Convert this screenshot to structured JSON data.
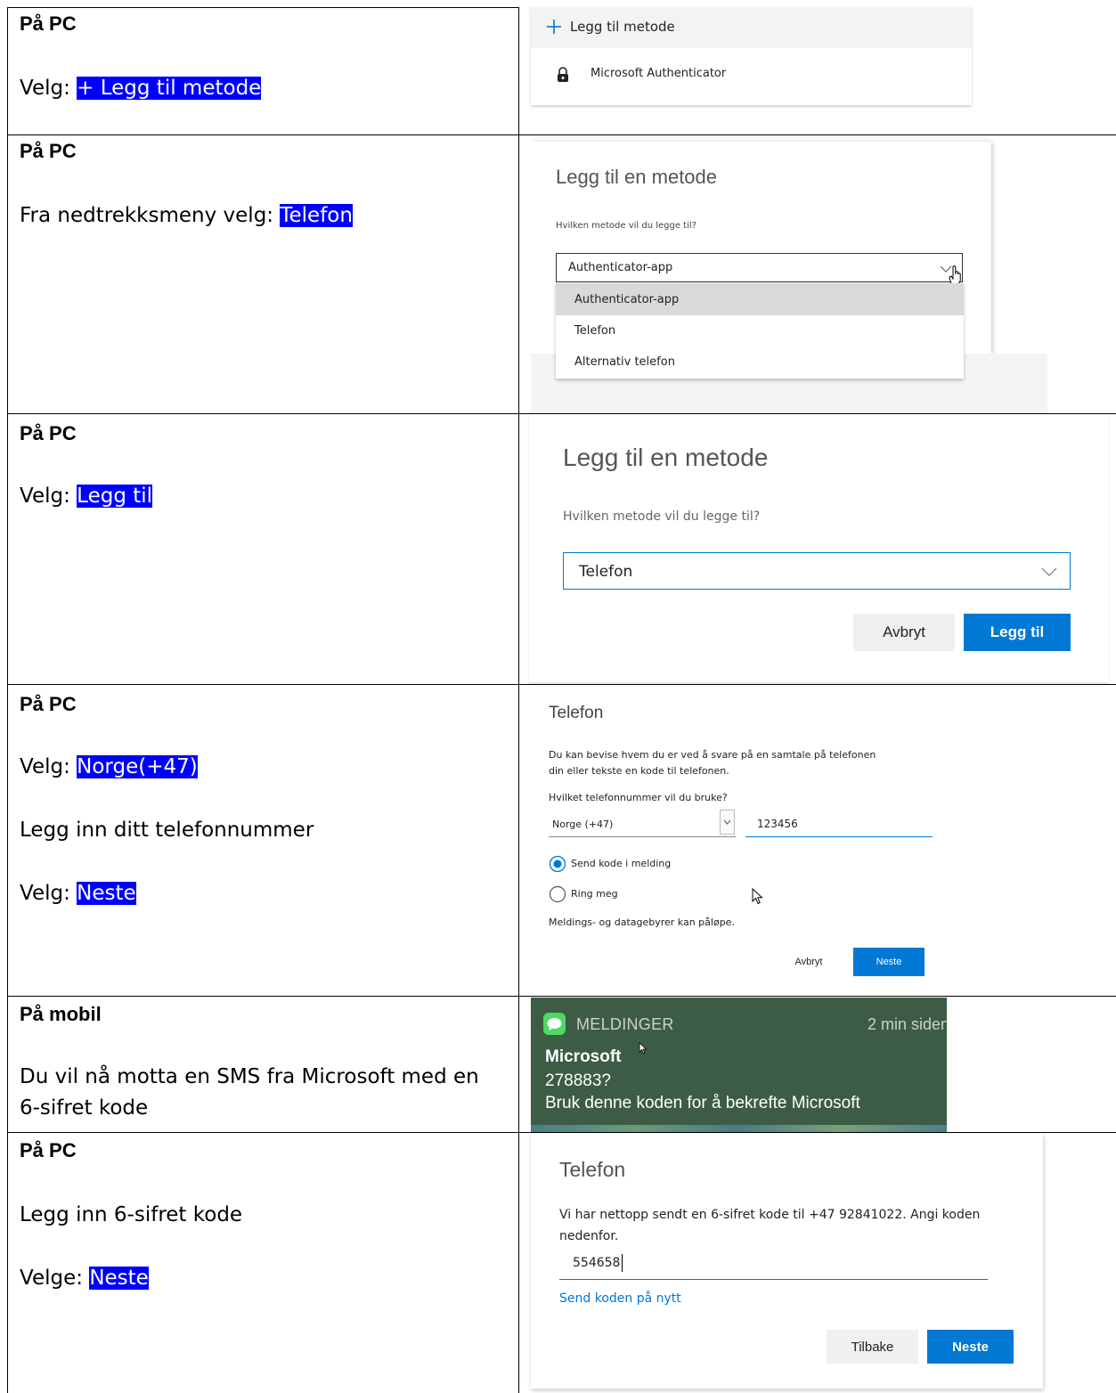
{
  "rows": [
    {
      "heading": "På PC",
      "lines": [
        {
          "prefix": "Velg: ",
          "highlight": "+ Legg til metode"
        }
      ],
      "shot": {
        "add_label": "Legg til metode",
        "item_label": "Microsoft Authenticator"
      }
    },
    {
      "heading": "På PC",
      "lines": [
        {
          "prefix": "Fra nedtrekksmeny velg: ",
          "highlight": "Telefon"
        }
      ],
      "shot": {
        "title": "Legg til en metode",
        "question": "Hvilken metode vil du legge til?",
        "selected": "Authenticator-app",
        "options": [
          "Authenticator-app",
          "Telefon",
          "Alternativ telefon"
        ]
      }
    },
    {
      "heading": "På PC",
      "lines": [
        {
          "prefix": "Velg: ",
          "highlight": "Legg til"
        }
      ],
      "shot": {
        "title": "Legg til en metode",
        "question": "Hvilken metode vil du legge til?",
        "selected": "Telefon",
        "cancel": "Avbryt",
        "add": "Legg til"
      }
    },
    {
      "heading": "På PC",
      "lines": [
        {
          "prefix": "Velg: ",
          "highlight": "Norge(+47)"
        },
        {
          "prefix": "Legg inn ditt telefonnummer",
          "highlight": ""
        },
        {
          "prefix": "Velg: ",
          "highlight": "Neste"
        }
      ],
      "shot": {
        "title": "Telefon",
        "desc1": "Du kan bevise hvem du er ved å svare på en samtale på telefonen",
        "desc2": "din eller tekste en kode til telefonen.",
        "question": "Hvilket telefonnummer vil du bruke?",
        "country": "Norge (+47)",
        "number": "123456",
        "opt_sms": "Send kode i melding",
        "opt_call": "Ring meg",
        "fees": "Meldings- og datagebyrer kan påløpe.",
        "cancel": "Avbryt",
        "next": "Neste"
      }
    },
    {
      "heading": "På mobil",
      "lines": [
        {
          "prefix": "Du vil nå motta en SMS fra Microsoft med en",
          "highlight": ""
        },
        {
          "prefix": "6-sifret kode",
          "highlight": ""
        }
      ],
      "shot": {
        "app": "MELDINGER",
        "time": "2 min siden",
        "sender": "Microsoft",
        "code": "278883?",
        "body": "Bruk denne koden for å bekrefte Microsoft"
      }
    },
    {
      "heading": "På PC",
      "lines": [
        {
          "prefix": "Legg inn 6-sifret kode",
          "highlight": ""
        },
        {
          "prefix": "Velge: ",
          "highlight": "Neste"
        }
      ],
      "shot": {
        "title": "Telefon",
        "desc1": "Vi har nettopp sendt en 6-sifret kode til +47 92841022. Angi koden",
        "desc2": "nedenfor.",
        "code": "554658",
        "resend": "Send koden på nytt",
        "back": "Tilbake",
        "next": "Neste"
      }
    }
  ],
  "colors": {
    "highlight_bg": "#0000ff",
    "highlight_fg": "#ffffff",
    "accent": "#0078d4",
    "sms_bg": "#3d5c45"
  }
}
